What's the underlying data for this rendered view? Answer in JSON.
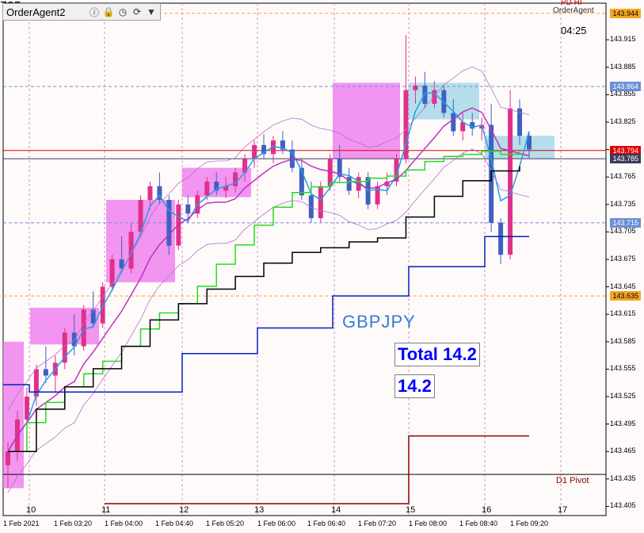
{
  "toolbar": {
    "title": "OrderAgent2",
    "number_label": "785",
    "icons": [
      "info-icon",
      "lock-icon",
      "history-icon",
      "refresh-icon",
      "dropdown-icon"
    ]
  },
  "header": {
    "pd_hi_label": "PD HI",
    "agent_label": "OrderAgent",
    "timer": "04:25"
  },
  "annotations": {
    "symbol": "GBPJPY",
    "total_label": "Total 14.2",
    "value_label": "14.2",
    "pivot_label": "D1 Pivot"
  },
  "price_tags": [
    {
      "text": "143.944",
      "color": "#f5a623",
      "text_color": "#000000"
    },
    {
      "text": "143.864",
      "color": "#6b8fd6",
      "text_color": "#ffffff"
    },
    {
      "text": "143.794",
      "color": "#e00000",
      "text_color": "#ffffff"
    },
    {
      "text": "143.785",
      "color": "#3c3c5a",
      "text_color": "#ffffff"
    },
    {
      "text": "143.715",
      "color": "#6b8fd6",
      "text_color": "#ffffff"
    },
    {
      "text": "143.635",
      "color": "#f5a623",
      "text_color": "#000000"
    }
  ],
  "chart_data": {
    "type": "candlestick",
    "symbol": "GBPJPY",
    "y_ticks": [
      "143.915",
      "143.885",
      "143.855",
      "143.825",
      "143.795",
      "143.765",
      "143.735",
      "143.705",
      "143.675",
      "143.645",
      "143.615",
      "143.585",
      "143.555",
      "143.525",
      "143.495",
      "143.465",
      "143.435",
      "143.405"
    ],
    "x_ticks": [
      "1 Feb 2021",
      "1 Feb 03:20",
      "1 Feb 04:00",
      "1 Feb 04:40",
      "1 Feb 05:20",
      "1 Feb 06:00",
      "1 Feb 06:40",
      "1 Feb 07:20",
      "1 Feb 08:00",
      "1 Feb 08:40",
      "1 Feb 09:20"
    ],
    "day_ticks": [
      "10",
      "11",
      "12",
      "13",
      "14",
      "15",
      "16",
      "17"
    ],
    "ylim": [
      143.395,
      143.955
    ],
    "candles": [
      {
        "o": 143.45,
        "h": 143.475,
        "l": 143.425,
        "c": 143.465
      },
      {
        "o": 143.465,
        "h": 143.51,
        "l": 143.455,
        "c": 143.5
      },
      {
        "o": 143.5,
        "h": 143.535,
        "l": 143.49,
        "c": 143.525
      },
      {
        "o": 143.525,
        "h": 143.56,
        "l": 143.515,
        "c": 143.555
      },
      {
        "o": 143.555,
        "h": 143.58,
        "l": 143.54,
        "c": 143.548
      },
      {
        "o": 143.548,
        "h": 143.57,
        "l": 143.53,
        "c": 143.562
      },
      {
        "o": 143.562,
        "h": 143.6,
        "l": 143.555,
        "c": 143.595
      },
      {
        "o": 143.595,
        "h": 143.615,
        "l": 143.57,
        "c": 143.58
      },
      {
        "o": 143.58,
        "h": 143.625,
        "l": 143.575,
        "c": 143.62
      },
      {
        "o": 143.62,
        "h": 143.64,
        "l": 143.6,
        "c": 143.605
      },
      {
        "o": 143.605,
        "h": 143.65,
        "l": 143.6,
        "c": 143.645
      },
      {
        "o": 143.645,
        "h": 143.68,
        "l": 143.64,
        "c": 143.675
      },
      {
        "o": 143.675,
        "h": 143.7,
        "l": 143.66,
        "c": 143.665
      },
      {
        "o": 143.665,
        "h": 143.715,
        "l": 143.66,
        "c": 143.705
      },
      {
        "o": 143.705,
        "h": 143.745,
        "l": 143.7,
        "c": 143.74
      },
      {
        "o": 143.74,
        "h": 143.76,
        "l": 143.73,
        "c": 143.755
      },
      {
        "o": 143.755,
        "h": 143.77,
        "l": 143.735,
        "c": 143.74
      },
      {
        "o": 143.74,
        "h": 143.745,
        "l": 143.68,
        "c": 143.69
      },
      {
        "o": 143.69,
        "h": 143.74,
        "l": 143.685,
        "c": 143.735
      },
      {
        "o": 143.735,
        "h": 143.745,
        "l": 143.715,
        "c": 143.725
      },
      {
        "o": 143.725,
        "h": 143.75,
        "l": 143.72,
        "c": 143.745
      },
      {
        "o": 143.745,
        "h": 143.765,
        "l": 143.74,
        "c": 143.76
      },
      {
        "o": 143.76,
        "h": 143.77,
        "l": 143.745,
        "c": 143.75
      },
      {
        "o": 143.75,
        "h": 143.765,
        "l": 143.742,
        "c": 143.755
      },
      {
        "o": 143.755,
        "h": 143.775,
        "l": 143.748,
        "c": 143.77
      },
      {
        "o": 143.77,
        "h": 143.79,
        "l": 143.76,
        "c": 143.785
      },
      {
        "o": 143.785,
        "h": 143.805,
        "l": 143.775,
        "c": 143.8
      },
      {
        "o": 143.8,
        "h": 143.812,
        "l": 143.785,
        "c": 143.79
      },
      {
        "o": 143.79,
        "h": 143.81,
        "l": 143.78,
        "c": 143.805
      },
      {
        "o": 143.805,
        "h": 143.815,
        "l": 143.79,
        "c": 143.795
      },
      {
        "o": 143.795,
        "h": 143.805,
        "l": 143.77,
        "c": 143.775
      },
      {
        "o": 143.775,
        "h": 143.785,
        "l": 143.74,
        "c": 143.745
      },
      {
        "o": 143.745,
        "h": 143.76,
        "l": 143.715,
        "c": 143.72
      },
      {
        "o": 143.72,
        "h": 143.76,
        "l": 143.715,
        "c": 143.755
      },
      {
        "o": 143.755,
        "h": 143.79,
        "l": 143.75,
        "c": 143.785
      },
      {
        "o": 143.785,
        "h": 143.8,
        "l": 143.76,
        "c": 143.765
      },
      {
        "o": 143.765,
        "h": 143.775,
        "l": 143.745,
        "c": 143.75
      },
      {
        "o": 143.75,
        "h": 143.77,
        "l": 143.742,
        "c": 143.765
      },
      {
        "o": 143.765,
        "h": 143.77,
        "l": 143.73,
        "c": 143.735
      },
      {
        "o": 143.735,
        "h": 143.76,
        "l": 143.73,
        "c": 143.755
      },
      {
        "o": 143.755,
        "h": 143.77,
        "l": 143.745,
        "c": 143.76
      },
      {
        "o": 143.76,
        "h": 143.79,
        "l": 143.755,
        "c": 143.785
      },
      {
        "o": 143.785,
        "h": 143.92,
        "l": 143.78,
        "c": 143.86
      },
      {
        "o": 143.86,
        "h": 143.875,
        "l": 143.845,
        "c": 143.865
      },
      {
        "o": 143.865,
        "h": 143.88,
        "l": 143.84,
        "c": 143.845
      },
      {
        "o": 143.845,
        "h": 143.87,
        "l": 143.84,
        "c": 143.86
      },
      {
        "o": 143.86,
        "h": 143.865,
        "l": 143.83,
        "c": 143.835
      },
      {
        "o": 143.835,
        "h": 143.85,
        "l": 143.81,
        "c": 143.815
      },
      {
        "o": 143.815,
        "h": 143.835,
        "l": 143.805,
        "c": 143.825
      },
      {
        "o": 143.825,
        "h": 143.835,
        "l": 143.81,
        "c": 143.818
      },
      {
        "o": 143.818,
        "h": 143.83,
        "l": 143.805,
        "c": 143.822
      },
      {
        "o": 143.822,
        "h": 143.845,
        "l": 143.705,
        "c": 143.715
      },
      {
        "o": 143.715,
        "h": 143.72,
        "l": 143.67,
        "c": 143.68
      },
      {
        "o": 143.68,
        "h": 143.86,
        "l": 143.675,
        "c": 143.84
      },
      {
        "o": 143.84,
        "h": 143.85,
        "l": 143.8,
        "c": 143.81
      },
      {
        "o": 143.81,
        "h": 143.815,
        "l": 143.785,
        "c": 143.795
      }
    ],
    "level_lines": [
      {
        "value": 143.944,
        "color": "#f5a623",
        "style": "dashed"
      },
      {
        "value": 143.864,
        "color": "#6b8fd6",
        "style": "dashed"
      },
      {
        "value": 143.794,
        "color": "#e00000",
        "style": "solid"
      },
      {
        "value": 143.785,
        "color": "#3c3c5a",
        "style": "solid"
      },
      {
        "value": 143.715,
        "color": "#6b8fd6",
        "style": "dashed"
      },
      {
        "value": 143.635,
        "color": "#f5a623",
        "style": "dashed"
      },
      {
        "value": 143.44,
        "color": "#000000",
        "style": "solid"
      }
    ]
  }
}
